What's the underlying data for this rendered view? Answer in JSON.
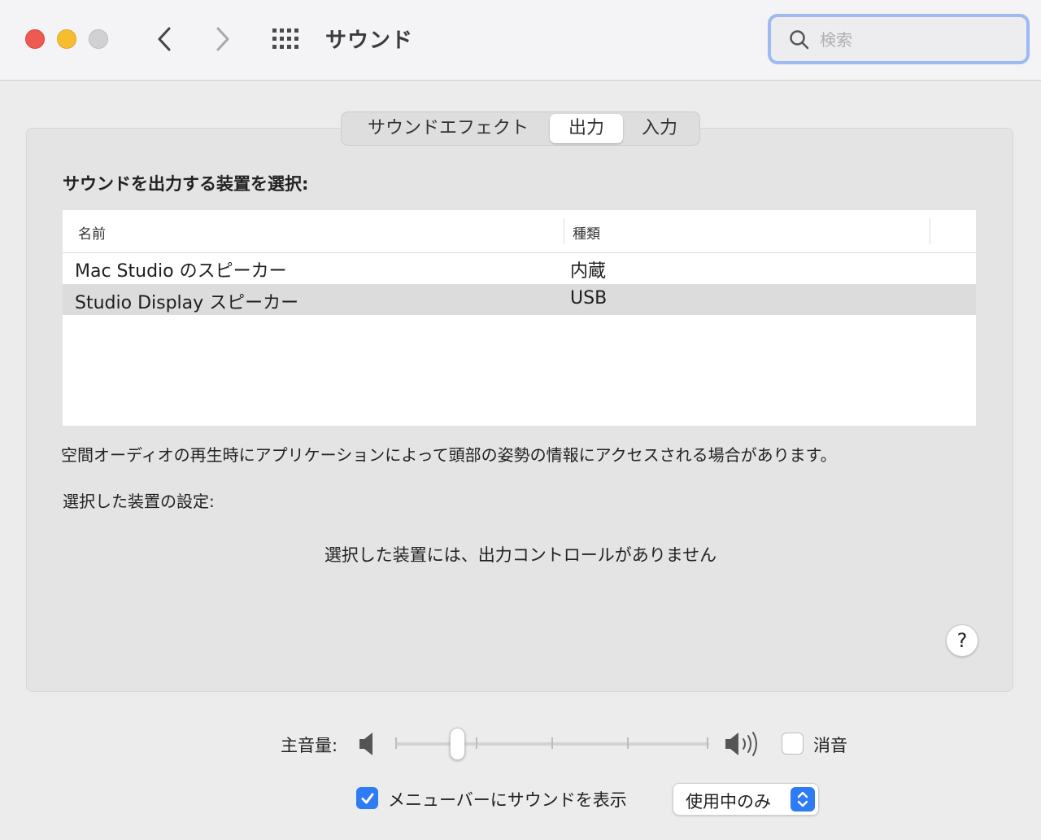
{
  "window": {
    "title": "サウンド"
  },
  "search": {
    "placeholder": "検索",
    "value": ""
  },
  "tabs": [
    {
      "label": "サウンドエフェクト",
      "selected": false
    },
    {
      "label": "出力",
      "selected": true
    },
    {
      "label": "入力",
      "selected": false
    }
  ],
  "output": {
    "heading": "サウンドを出力する装置を選択:",
    "columns": [
      "名前",
      "種類"
    ],
    "devices": [
      {
        "name": "Mac Studio のスピーカー",
        "type": "内蔵",
        "selected": false
      },
      {
        "name": "Studio Display スピーカー",
        "type": "USB",
        "selected": true
      }
    ],
    "spatial_note": "空間オーディオの再生時にアプリケーションによって頭部の姿勢の情報にアクセスされる場合があります。",
    "settings_label": "選択した装置の設定:",
    "no_controls_message": "選択した装置には、出力コントロールがありません"
  },
  "help": {
    "label": "?"
  },
  "volume": {
    "label": "主音量:",
    "level": 0.2,
    "mute_label": "消音",
    "muted": false
  },
  "menubar": {
    "show_label": "メニューバーにサウンドを表示",
    "checked": true,
    "option_selected": "使用中のみ"
  },
  "colors": {
    "accent": "#2d7cf6",
    "close": "#ee5a52",
    "minimize": "#f6bd31",
    "zoom": "#d1d0d2",
    "search_focus_ring": "#9dbaf2"
  }
}
